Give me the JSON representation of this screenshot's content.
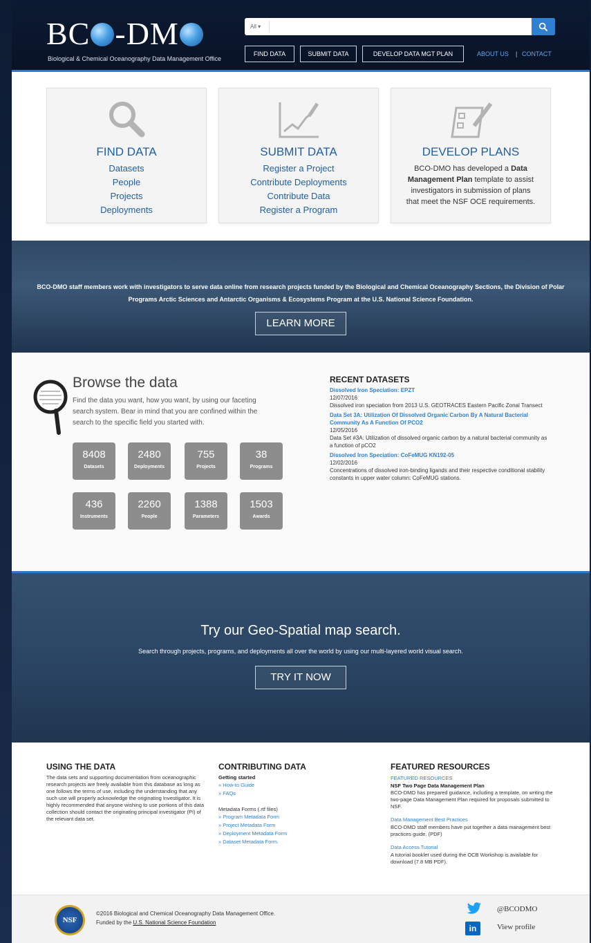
{
  "header": {
    "logo_text_1": "BC",
    "logo_text_2": "-DM",
    "logo_subtitle": "Biological & Chemical Oceanography Data Management Office",
    "search": {
      "scope": "All",
      "placeholder": ""
    },
    "nav": [
      "FIND DATA",
      "SUBMIT DATA",
      "DEVELOP DATA MGT PLAN"
    ],
    "about": "ABOUT US",
    "separator": "|",
    "contact": "CONTACT"
  },
  "features": {
    "find": {
      "title": "FIND DATA",
      "links": [
        "Datasets",
        "People",
        "Projects",
        "Deployments"
      ],
      "icon": "magnifier-icon"
    },
    "submit": {
      "title": "SUBMIT DATA",
      "links": [
        "Register a Project",
        "Contribute Deployments",
        "Contribute Data",
        "Register a Program"
      ],
      "icon": "chart-icon"
    },
    "plans": {
      "title": "DEVELOP PLANS",
      "desc_1": "BCO-DMO has developed a ",
      "desc_bold": "Data Management Plan",
      "desc_2": " template to assist investigators in submission of plans that meet the NSF OCE requirements.",
      "icon": "checklist-pencil-icon"
    }
  },
  "banner1": {
    "text": "BCO-DMO staff members work with investigators to serve data online from research projects funded by the Biological and Chemical Oceanography Sections, the Division of Polar Programs Arctic Sciences and Antarctic Organisms & Ecosystems Program at the U.S. National Science Foundation.",
    "button": "LEARN MORE"
  },
  "browse": {
    "title": "Browse the data",
    "intro": "Find the data you want, how you want,  by using our faceting search system. Bear in mind that you are confined within the search to the specific field you started with.",
    "stats": [
      {
        "num": "8408",
        "label": "Datasets"
      },
      {
        "num": "2480",
        "label": "Deployments"
      },
      {
        "num": "755",
        "label": "Projects"
      },
      {
        "num": "38",
        "label": "Programs"
      },
      {
        "num": "436",
        "label": "Instruments"
      },
      {
        "num": "2260",
        "label": "People"
      },
      {
        "num": "1388",
        "label": "Parameters"
      },
      {
        "num": "1503",
        "label": "Awards"
      }
    ]
  },
  "recent": {
    "heading": "RECENT DATASETS",
    "items": [
      {
        "title": "Dissolved Iron Speciation: EPZT",
        "date": "12/07/2016",
        "summary": "Dissolved iron speciation from 2013 U.S. GEOTRACES Eastern Pacific Zonal Transect"
      },
      {
        "title": "Data Set 3A: Utilization Of Dissolved Organic Carbon By A Natural Bacterial Community As A Function Of PCO2",
        "date": "12/05/2016",
        "summary": "Data Set #3A: Utilization of dissolved organic carbon by a natural bacterial community as a function of pCO2"
      },
      {
        "title": "Dissolved Iron Speciation: CoFeMUG KN192-05",
        "date": "12/02/2016",
        "summary": "Concentrations of dissolved iron-binding ligands and their respective conditional stability constants in upper water column: CoFeMUG stations."
      }
    ]
  },
  "banner2": {
    "title": "Try our Geo-Spatial map search.",
    "text": "Search through projects, programs, and deployments all over the world by using our multi-layered world visual search.",
    "button": "TRY IT NOW"
  },
  "footer": {
    "using": {
      "heading": "USING THE DATA",
      "text": "The data sets and supporting documentation from oceanographic research projects are freely available from this database as long as one follows the terms of use, including the understanding that any such use will properly acknowledge the originating Investigator. It is highly recommended that anyone wishing to use portions of this data collection should contact the originating principal investigator (PI) of the relevant data set."
    },
    "contributing": {
      "heading": "CONTRIBUTING DATA",
      "getting_started": "Getting started",
      "links1": [
        "» How-to Guide",
        "» FAQs"
      ],
      "forms_label": "Metadata Forms (.rtf files)",
      "links2": [
        "» Program Metadata Form",
        "» Project Metadata Form",
        "» Deployment Metadata Form",
        "» Dataset Metadata Form."
      ]
    },
    "featured": {
      "heading": "FEATURED RESOURCES",
      "sub": "FEATURED RESOURCES",
      "item1_title": "NSF Two Page Data Management Plan",
      "item1_text": "BCO-DMO has prepared guidance, including a template, on writing the two-page Data Management Plan required for proposals submitted to NSF.",
      "item2_title": "Data Management Best Practices",
      "item2_text": "BCO-DMO staff members have put together a data management best practices guide. (PDF)",
      "item3_title": "Data Access Tutorial",
      "item3_text": "A tutorial booklet used during the OCB Workshop is available for download (7.8 MB PDF)."
    }
  },
  "bottom": {
    "nsf_logo": "NSF",
    "copyright": "©2016 Biological and Chemical Oceanography Data Management Office.",
    "funded_prefix": "Funded by the ",
    "funded_link": "U.S. National Science Foundation",
    "twitter": "@BCODMO",
    "linkedin": "View profile"
  }
}
